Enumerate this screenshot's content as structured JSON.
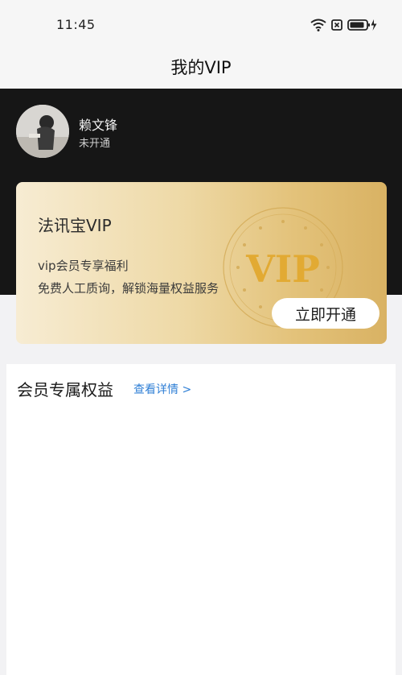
{
  "status_bar": {
    "time": "11:45",
    "icons": [
      "wifi-icon",
      "sim-off-icon",
      "battery-charging-icon"
    ]
  },
  "nav": {
    "title": "我的VIP"
  },
  "user": {
    "name": "赖文锋",
    "status": "未开通"
  },
  "vip_card": {
    "title": "法讯宝VIP",
    "subtitle": "vip会员专享福利",
    "description": "免费人工质询，解锁海量权益服务",
    "seal_text": "VIP",
    "button_label": "立即开通"
  },
  "benefits": {
    "title": "会员专属权益",
    "link": "查看详情 >"
  },
  "colors": {
    "header_bg": "#161616",
    "card_gold": "#e3c27a",
    "link_blue": "#2f7fd6"
  }
}
